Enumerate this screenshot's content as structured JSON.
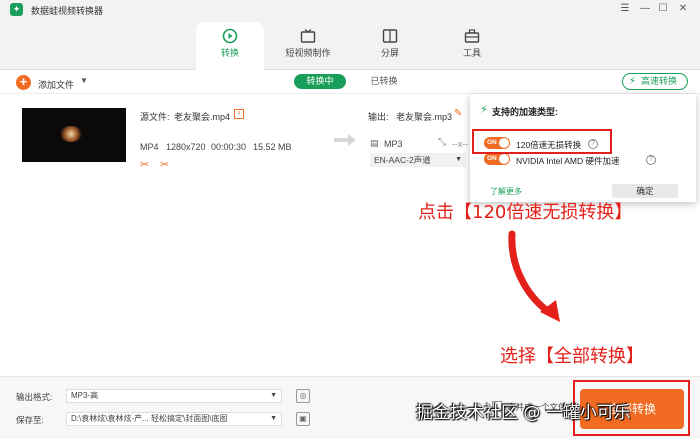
{
  "window": {
    "title": "数据蛙视频转换器",
    "logo_glyph": "✦",
    "controls": {
      "menu": "☰",
      "minimize": "—",
      "maximize": "☐",
      "close": "✕"
    }
  },
  "nav": {
    "tabs": [
      {
        "label": "转换",
        "icon": "convert-icon",
        "active": true
      },
      {
        "label": "短视频制作",
        "icon": "tv-icon",
        "active": false
      },
      {
        "label": "分屏",
        "icon": "split-screen-icon",
        "active": false
      },
      {
        "label": "工具",
        "icon": "toolbox-icon",
        "active": false
      }
    ]
  },
  "toolbar": {
    "add_glyph": "+",
    "add_file_label": "添加文件",
    "add_file_caret": "▼",
    "status_tabs": [
      {
        "label": "转换中",
        "active": true
      },
      {
        "label": "已转换",
        "active": false
      }
    ],
    "accel_label": "高速转换",
    "accel_glyph": "⚡"
  },
  "file": {
    "source_label": "源文件:",
    "source_name": "老友聚会.mp4",
    "info_glyph": "i",
    "format": "MP4",
    "resolution": "1280x720",
    "duration": "00:00:30",
    "size": "15.52 MB",
    "tool_glyphs": [
      "✂",
      "✂"
    ],
    "output_label": "输出:",
    "output_name": "老友聚会.mp3",
    "edit_glyph": "✎",
    "output_format": "MP3",
    "format_glyph": "▤",
    "resize_glyph": "⤡",
    "dims": "--x--",
    "audio_track": "EN-AAC-2声道",
    "audio_caret": "▼"
  },
  "accel_popup": {
    "bolt_glyph": "⚡",
    "title": "支持的加速类型:",
    "options": [
      {
        "toggle": "ON",
        "label": "120倍速无损转换",
        "help": "?"
      },
      {
        "toggle": "ON",
        "label": "NVIDIA  Intel  AMD  硬件加速",
        "help": "?"
      }
    ],
    "learn_more": "了解更多",
    "ok_label": "确定"
  },
  "annotations": {
    "step1": "点击【120倍速无损转换】",
    "step2": "选择【全部转换】",
    "highlight_color": "#e3201a"
  },
  "footer": {
    "output_format_label": "输出格式:",
    "output_format_value": "MP3-高",
    "save_to_label": "保存至:",
    "save_to_value": "D:\\袁林炫\\袁林炫-产... 轻松搞定\\封面图\\底图",
    "select_caret": "▼",
    "format_icon_glyph": "◎",
    "folder_icon_glyph": "▣",
    "merge_label": "合并成一个文件",
    "convert_all_label": "全部转换"
  },
  "watermark": "掘金技术社区 @ 一罐小可乐",
  "colors": {
    "brand_green": "#1a9f5a",
    "accent_orange": "#f26b22"
  }
}
